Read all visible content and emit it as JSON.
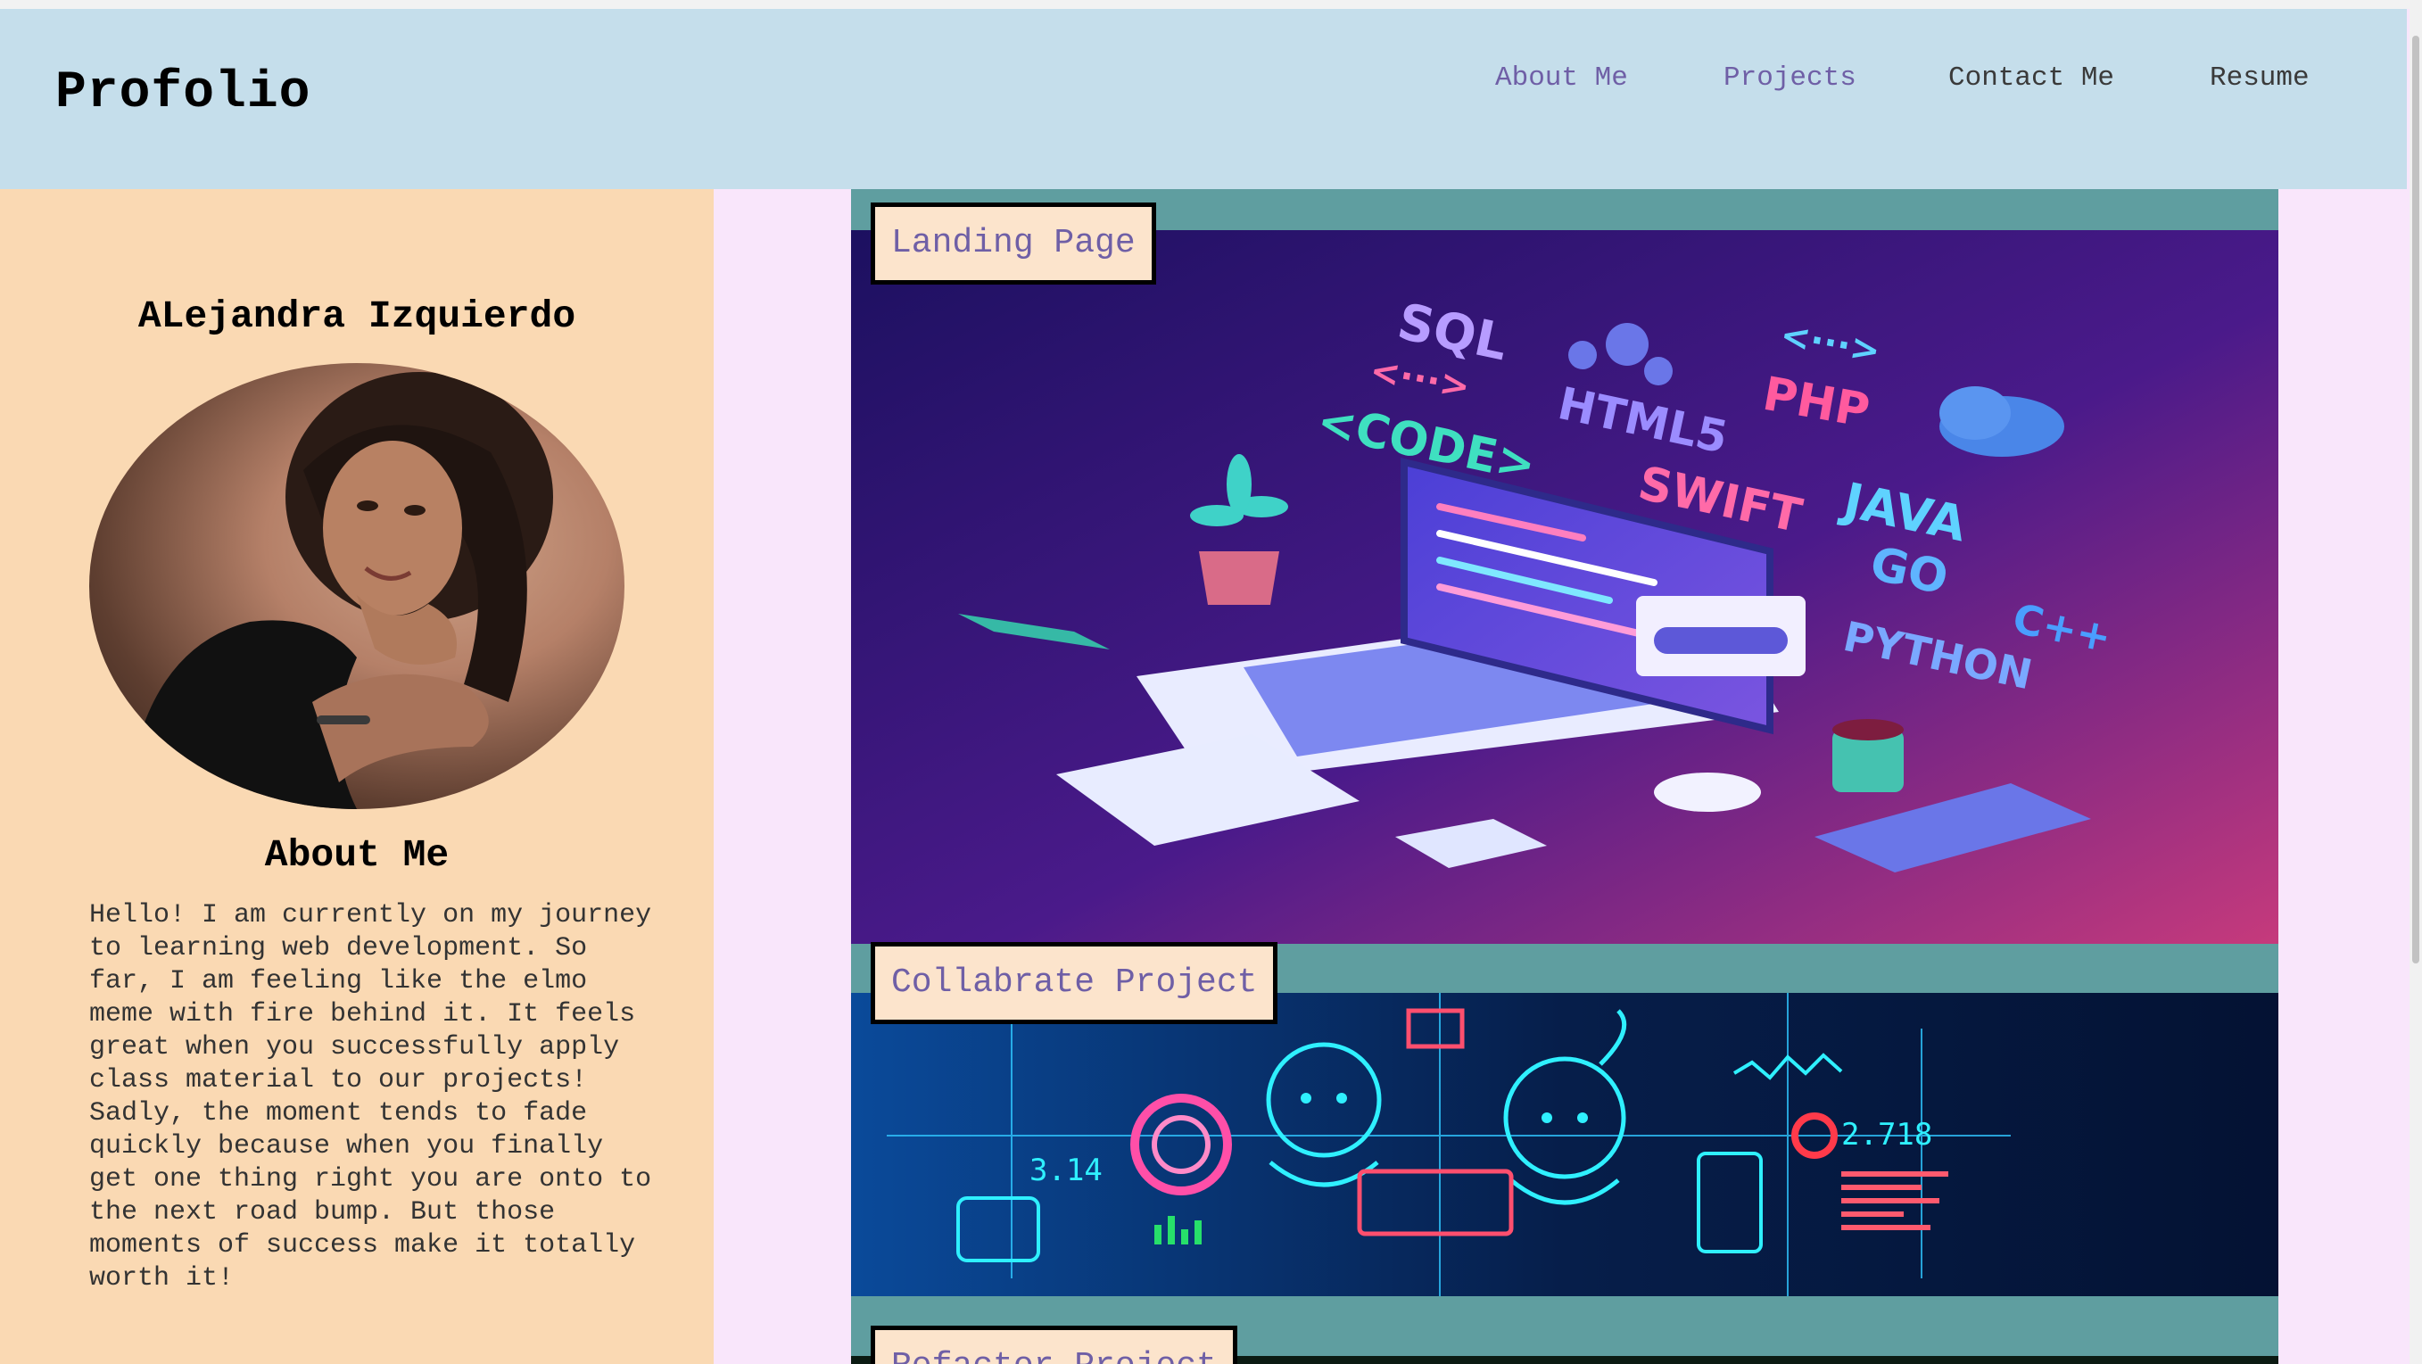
{
  "brand": "Profolio",
  "nav": {
    "about": "About Me",
    "projects": "Projects",
    "contact": "Contact Me",
    "resume": "Resume"
  },
  "profile": {
    "name": "ALejandra Izquierdo",
    "about_title": "About Me",
    "about_text": "Hello! I am currently on my journey to learning web development. So far, I am feeling like the elmo meme with fire behind it. It feels great when you successfully apply class material to our projects! Sadly, the moment tends to fade quickly because when you finally get one thing right you are onto to the next road bump. But those moments of success make it totally worth it!"
  },
  "projects": [
    {
      "label": "Landing Page"
    },
    {
      "label": "Collabrate Project"
    },
    {
      "label": "Refactor Project"
    }
  ],
  "landing_art": {
    "words": [
      "SQL",
      "HTML5",
      "PHP",
      "<CODE>",
      "SWIFT",
      "JAVA",
      "GO",
      "PYTHON",
      "C++",
      "<···>",
      "<···>"
    ]
  },
  "collab_art": {
    "numbers": [
      "3.14",
      "2.718"
    ]
  },
  "colors": {
    "header_bg": "#c5deeb",
    "sidebar_bg": "#fad9b3",
    "page_bg": "#f9e6fb",
    "projects_bg": "#5f9ea0",
    "nav_link_visited": "#6f5fa6"
  }
}
